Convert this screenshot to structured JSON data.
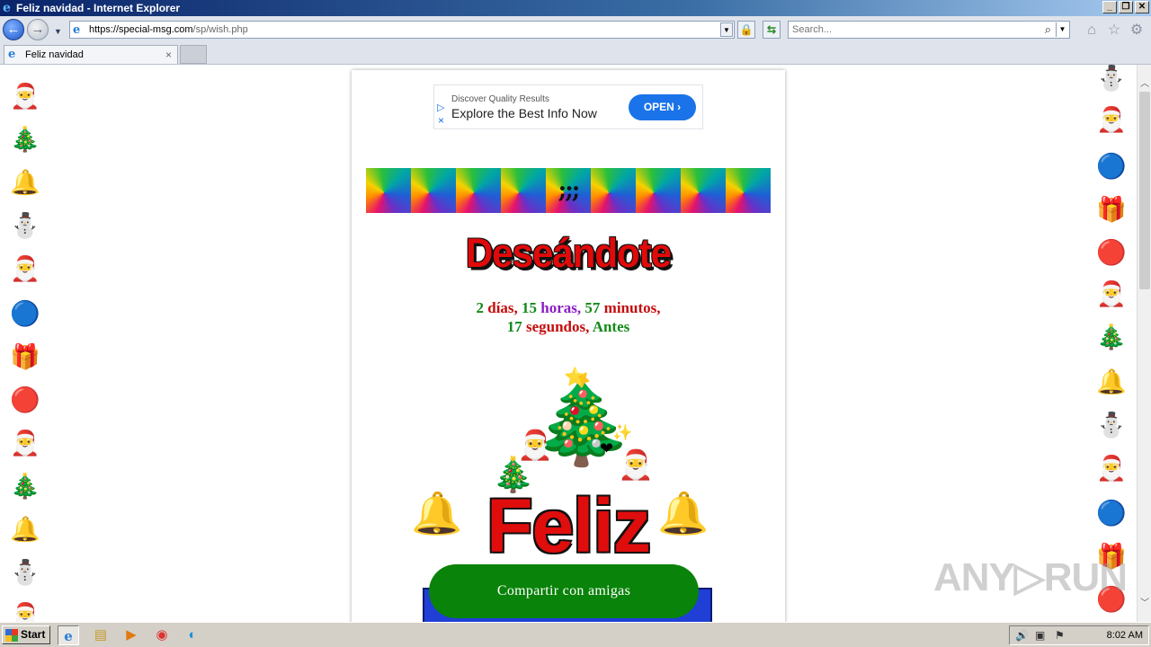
{
  "window": {
    "title": "Feliz navidad - Internet Explorer",
    "buttons": [
      "_",
      "❐",
      "✕"
    ]
  },
  "addressbar": {
    "url_host": "https://special-msg.com",
    "url_path": "/sp/wish.php",
    "search_placeholder": "Search..."
  },
  "tab": {
    "label": "Feliz navidad",
    "close": "×"
  },
  "ad": {
    "small_text": "Discover Quality Results",
    "headline": "Explore the Best Info Now",
    "button_label": "OPEN ›"
  },
  "banner": {
    "center_glyph": ";;;"
  },
  "page": {
    "heading": "Deseándote",
    "countdown": {
      "days_num": "2",
      "days_word": "días,",
      "hours_num": "15",
      "hours_word": "horas,",
      "minutes_num": "57",
      "minutes_word": "minutos,",
      "seconds_num": "17",
      "seconds_word": "segundos,",
      "suffix": "Antes"
    },
    "feliz": "Feliz",
    "share_label": "Compartir con amigas"
  },
  "decorations": {
    "left": [
      "🎅",
      "🎄",
      "🔔",
      "⛄",
      "🎅",
      "🔵",
      "🎁",
      "🔴",
      "🎅",
      "🎄",
      "🔔",
      "⛄",
      "🎅"
    ],
    "right": [
      "⛄",
      "🎅",
      "🔵",
      "🎁",
      "🔴",
      "🎅",
      "🎄",
      "🔔",
      "⛄",
      "🎅",
      "🔵",
      "🎁",
      "🔴"
    ]
  },
  "watermark": "ANY▷RUN",
  "taskbar": {
    "start_label": "Start",
    "clock": "8:02 AM"
  },
  "colors": {
    "share_button": "#098309",
    "heading_red": "#e10a0a",
    "ad_button": "#1a73e8"
  }
}
